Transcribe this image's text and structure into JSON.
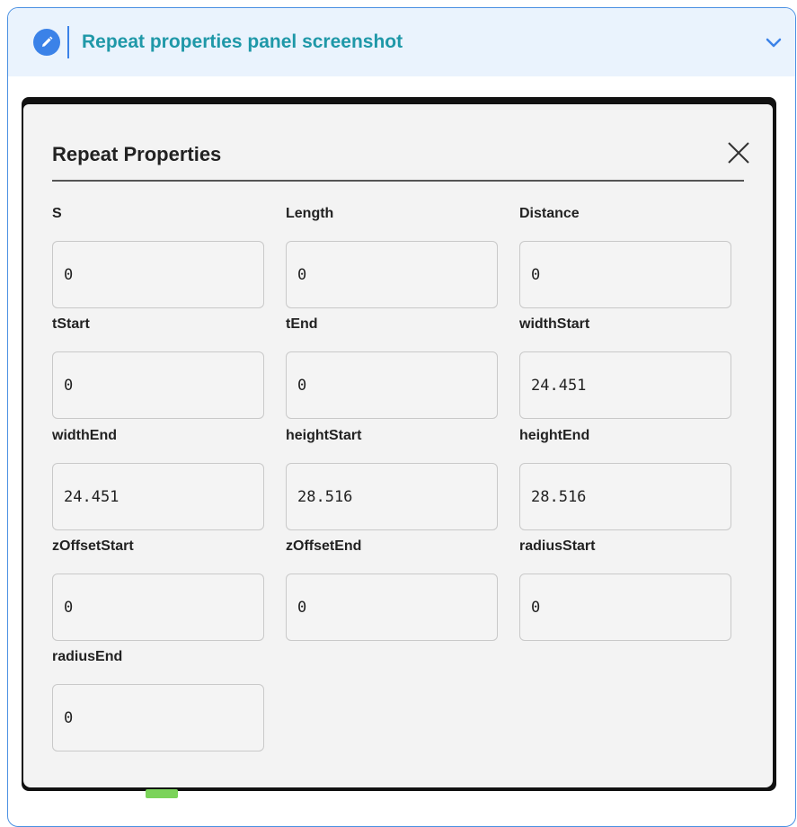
{
  "header": {
    "title": "Repeat properties panel screenshot"
  },
  "panel": {
    "title": "Repeat Properties",
    "fields": [
      {
        "label": "S",
        "value": "0"
      },
      {
        "label": "Length",
        "value": "0"
      },
      {
        "label": "Distance",
        "value": "0"
      },
      {
        "label": "tStart",
        "value": "0"
      },
      {
        "label": "tEnd",
        "value": "0"
      },
      {
        "label": "widthStart",
        "value": "24.451"
      },
      {
        "label": "widthEnd",
        "value": "24.451"
      },
      {
        "label": "heightStart",
        "value": "28.516"
      },
      {
        "label": "heightEnd",
        "value": "28.516"
      },
      {
        "label": "zOffsetStart",
        "value": "0"
      },
      {
        "label": "zOffsetEnd",
        "value": "0"
      },
      {
        "label": "radiusStart",
        "value": "0"
      },
      {
        "label": "radiusEnd",
        "value": "0"
      }
    ]
  },
  "colors": {
    "accent": "#3b82e8",
    "title_teal": "#1f98a8",
    "header_bg": "#eaf3fd",
    "panel_bg": "#f3f3f3"
  }
}
